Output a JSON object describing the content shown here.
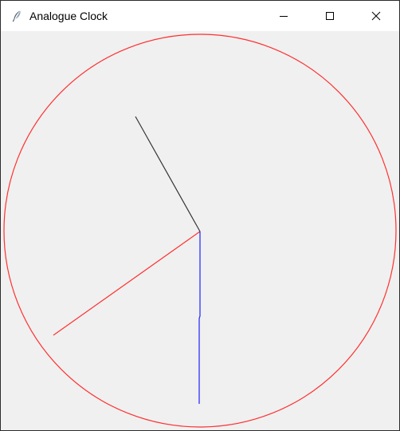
{
  "window": {
    "title": "Analogue Clock",
    "app_icon": "feather-icon",
    "controls": [
      "minimize-icon",
      "maximize-icon",
      "close-icon"
    ]
  },
  "clock": {
    "face_color": "#ff3030",
    "hour_hand_color": "#333333",
    "minute_hand_color": "#ff3030",
    "second_hand_color": "#2020ff"
  }
}
